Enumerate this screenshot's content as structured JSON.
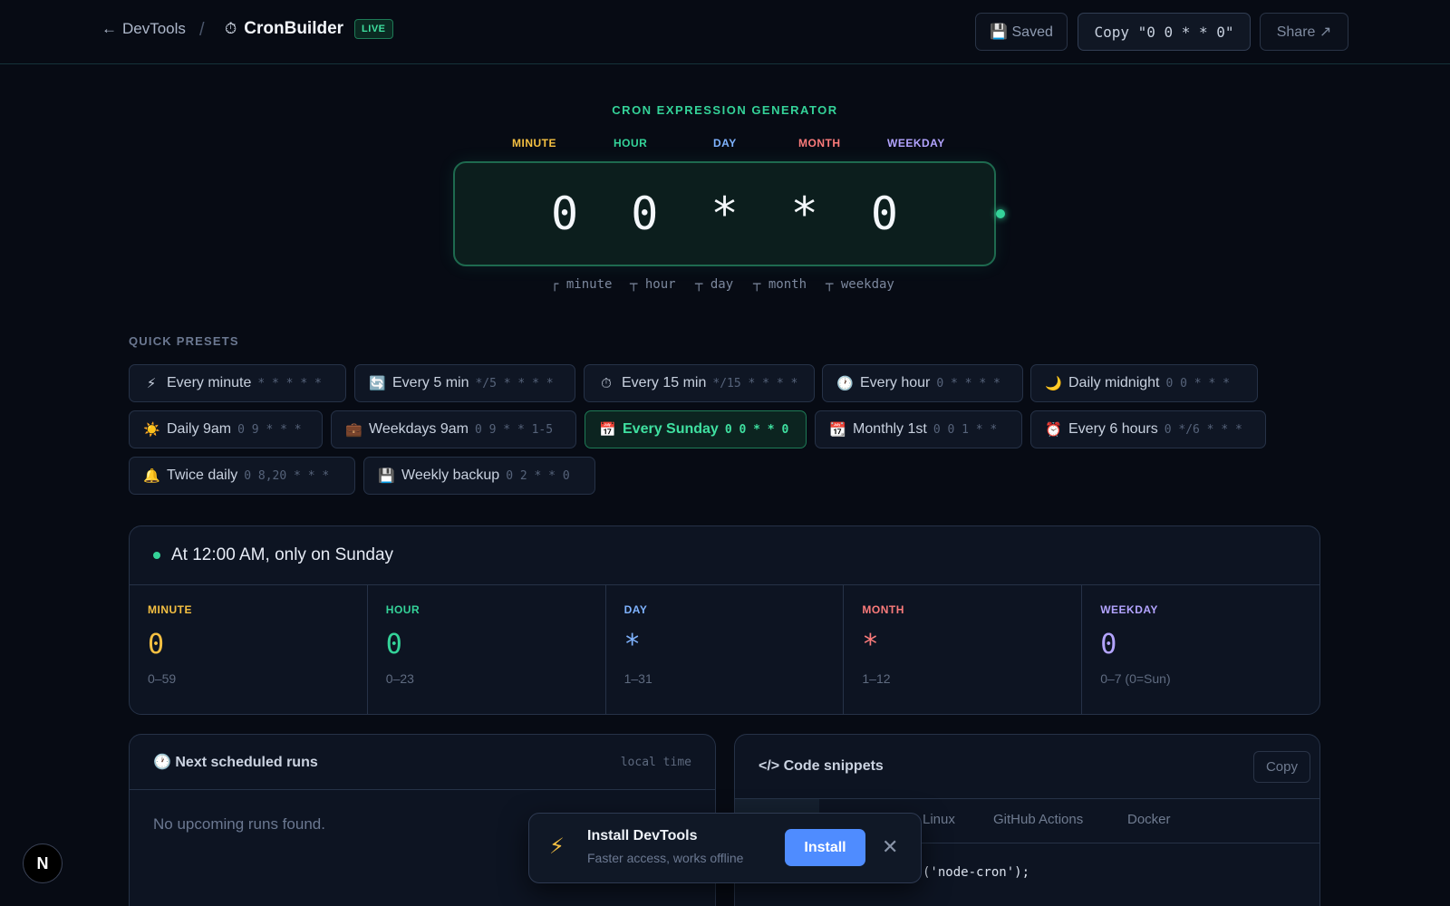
{
  "topbar": {
    "back_label": "DevTools",
    "separator": "/",
    "app_title": "CronBuilder",
    "live_badge": "LIVE",
    "saved_label": "💾 Saved",
    "copy_label": "Copy \"0 0 * * 0\"",
    "share_label": "Share ↗"
  },
  "generator": {
    "title": "CRON EXPRESSION GENERATOR",
    "field_labels": [
      "MINUTE",
      "HOUR",
      "DAY",
      "MONTH",
      "WEEKDAY"
    ],
    "expression": "0 0 * * 0",
    "legend": [
      "┌ minute",
      "┬ hour",
      "┬ day",
      "┬ month",
      "┬ weekday"
    ]
  },
  "presets": {
    "title": "QUICK PRESETS",
    "items": [
      {
        "icon": "⚡",
        "label": "Every minute",
        "cron": "* * * * *",
        "active": false
      },
      {
        "icon": "🔄",
        "label": "Every 5 min",
        "cron": "*/5 * * * *",
        "active": false
      },
      {
        "icon": "⏱",
        "label": "Every 15 min",
        "cron": "*/15 * * * *",
        "active": false
      },
      {
        "icon": "🕐",
        "label": "Every hour",
        "cron": "0 * * * *",
        "active": false
      },
      {
        "icon": "🌙",
        "label": "Daily midnight",
        "cron": "0 0 * * *",
        "active": false
      },
      {
        "icon": "☀️",
        "label": "Daily 9am",
        "cron": "0 9 * * *",
        "active": false
      },
      {
        "icon": "💼",
        "label": "Weekdays 9am",
        "cron": "0 9 * * 1-5",
        "active": false
      },
      {
        "icon": "📅",
        "label": "Every Sunday",
        "cron": "0 0 * * 0",
        "active": true
      },
      {
        "icon": "📆",
        "label": "Monthly 1st",
        "cron": "0 0 1 * *",
        "active": false
      },
      {
        "icon": "⏰",
        "label": "Every 6 hours",
        "cron": "0 */6 * * *",
        "active": false
      },
      {
        "icon": "🔔",
        "label": "Twice daily",
        "cron": "0 8,20 * * *",
        "active": false
      },
      {
        "icon": "💾",
        "label": "Weekly backup",
        "cron": "0 2 * * 0",
        "active": false
      }
    ]
  },
  "summary": {
    "description": "At 12:00 AM, only on Sunday",
    "fields": [
      {
        "label": "MINUTE",
        "value": "0",
        "range": "0–59"
      },
      {
        "label": "HOUR",
        "value": "0",
        "range": "0–23"
      },
      {
        "label": "DAY",
        "value": "*",
        "range": "1–31"
      },
      {
        "label": "MONTH",
        "value": "*",
        "range": "1–12"
      },
      {
        "label": "WEEKDAY",
        "value": "0",
        "range": "0–7 (0=Sun)"
      }
    ]
  },
  "runs": {
    "title": "🕐 Next scheduled runs",
    "tz_label": "local time",
    "empty": "No upcoming runs found."
  },
  "code": {
    "title": "</> Code snippets",
    "copy_label": "Copy",
    "tabs": [
      "Linux",
      "GitHub Actions",
      "Docker"
    ],
    "visible_line": "('node-cron');"
  },
  "toast": {
    "icon": "⚡",
    "title": "Install DevTools",
    "subtitle": "Faster access, works offline",
    "install_label": "Install",
    "close_label": "✕"
  },
  "corner_badge": "N"
}
